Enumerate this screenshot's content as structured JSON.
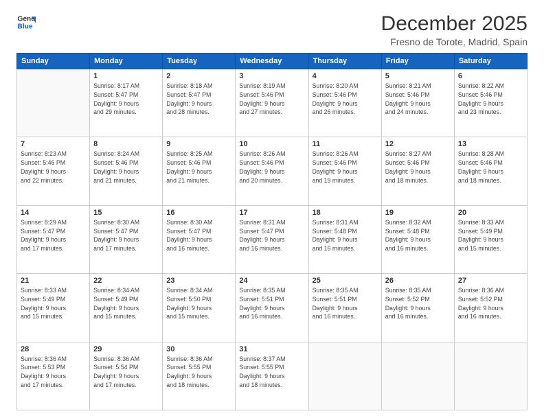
{
  "header": {
    "logo_line1": "General",
    "logo_line2": "Blue",
    "title": "December 2025",
    "subtitle": "Fresno de Torote, Madrid, Spain"
  },
  "weekdays": [
    "Sunday",
    "Monday",
    "Tuesday",
    "Wednesday",
    "Thursday",
    "Friday",
    "Saturday"
  ],
  "weeks": [
    [
      {
        "day": "",
        "info": ""
      },
      {
        "day": "1",
        "info": "Sunrise: 8:17 AM\nSunset: 5:47 PM\nDaylight: 9 hours\nand 29 minutes."
      },
      {
        "day": "2",
        "info": "Sunrise: 8:18 AM\nSunset: 5:47 PM\nDaylight: 9 hours\nand 28 minutes."
      },
      {
        "day": "3",
        "info": "Sunrise: 8:19 AM\nSunset: 5:46 PM\nDaylight: 9 hours\nand 27 minutes."
      },
      {
        "day": "4",
        "info": "Sunrise: 8:20 AM\nSunset: 5:46 PM\nDaylight: 9 hours\nand 26 minutes."
      },
      {
        "day": "5",
        "info": "Sunrise: 8:21 AM\nSunset: 5:46 PM\nDaylight: 9 hours\nand 24 minutes."
      },
      {
        "day": "6",
        "info": "Sunrise: 8:22 AM\nSunset: 5:46 PM\nDaylight: 9 hours\nand 23 minutes."
      }
    ],
    [
      {
        "day": "7",
        "info": "Sunrise: 8:23 AM\nSunset: 5:46 PM\nDaylight: 9 hours\nand 22 minutes."
      },
      {
        "day": "8",
        "info": "Sunrise: 8:24 AM\nSunset: 5:46 PM\nDaylight: 9 hours\nand 21 minutes."
      },
      {
        "day": "9",
        "info": "Sunrise: 8:25 AM\nSunset: 5:46 PM\nDaylight: 9 hours\nand 21 minutes."
      },
      {
        "day": "10",
        "info": "Sunrise: 8:26 AM\nSunset: 5:46 PM\nDaylight: 9 hours\nand 20 minutes."
      },
      {
        "day": "11",
        "info": "Sunrise: 8:26 AM\nSunset: 5:46 PM\nDaylight: 9 hours\nand 19 minutes."
      },
      {
        "day": "12",
        "info": "Sunrise: 8:27 AM\nSunset: 5:46 PM\nDaylight: 9 hours\nand 18 minutes."
      },
      {
        "day": "13",
        "info": "Sunrise: 8:28 AM\nSunset: 5:46 PM\nDaylight: 9 hours\nand 18 minutes."
      }
    ],
    [
      {
        "day": "14",
        "info": "Sunrise: 8:29 AM\nSunset: 5:47 PM\nDaylight: 9 hours\nand 17 minutes."
      },
      {
        "day": "15",
        "info": "Sunrise: 8:30 AM\nSunset: 5:47 PM\nDaylight: 9 hours\nand 17 minutes."
      },
      {
        "day": "16",
        "info": "Sunrise: 8:30 AM\nSunset: 5:47 PM\nDaylight: 9 hours\nand 16 minutes."
      },
      {
        "day": "17",
        "info": "Sunrise: 8:31 AM\nSunset: 5:47 PM\nDaylight: 9 hours\nand 16 minutes."
      },
      {
        "day": "18",
        "info": "Sunrise: 8:31 AM\nSunset: 5:48 PM\nDaylight: 9 hours\nand 16 minutes."
      },
      {
        "day": "19",
        "info": "Sunrise: 8:32 AM\nSunset: 5:48 PM\nDaylight: 9 hours\nand 16 minutes."
      },
      {
        "day": "20",
        "info": "Sunrise: 8:33 AM\nSunset: 5:49 PM\nDaylight: 9 hours\nand 15 minutes."
      }
    ],
    [
      {
        "day": "21",
        "info": "Sunrise: 8:33 AM\nSunset: 5:49 PM\nDaylight: 9 hours\nand 15 minutes."
      },
      {
        "day": "22",
        "info": "Sunrise: 8:34 AM\nSunset: 5:49 PM\nDaylight: 9 hours\nand 15 minutes."
      },
      {
        "day": "23",
        "info": "Sunrise: 8:34 AM\nSunset: 5:50 PM\nDaylight: 9 hours\nand 15 minutes."
      },
      {
        "day": "24",
        "info": "Sunrise: 8:35 AM\nSunset: 5:51 PM\nDaylight: 9 hours\nand 16 minutes."
      },
      {
        "day": "25",
        "info": "Sunrise: 8:35 AM\nSunset: 5:51 PM\nDaylight: 9 hours\nand 16 minutes."
      },
      {
        "day": "26",
        "info": "Sunrise: 8:35 AM\nSunset: 5:52 PM\nDaylight: 9 hours\nand 16 minutes."
      },
      {
        "day": "27",
        "info": "Sunrise: 8:36 AM\nSunset: 5:52 PM\nDaylight: 9 hours\nand 16 minutes."
      }
    ],
    [
      {
        "day": "28",
        "info": "Sunrise: 8:36 AM\nSunset: 5:53 PM\nDaylight: 9 hours\nand 17 minutes."
      },
      {
        "day": "29",
        "info": "Sunrise: 8:36 AM\nSunset: 5:54 PM\nDaylight: 9 hours\nand 17 minutes."
      },
      {
        "day": "30",
        "info": "Sunrise: 8:36 AM\nSunset: 5:55 PM\nDaylight: 9 hours\nand 18 minutes."
      },
      {
        "day": "31",
        "info": "Sunrise: 8:37 AM\nSunset: 5:55 PM\nDaylight: 9 hours\nand 18 minutes."
      },
      {
        "day": "",
        "info": ""
      },
      {
        "day": "",
        "info": ""
      },
      {
        "day": "",
        "info": ""
      }
    ]
  ]
}
